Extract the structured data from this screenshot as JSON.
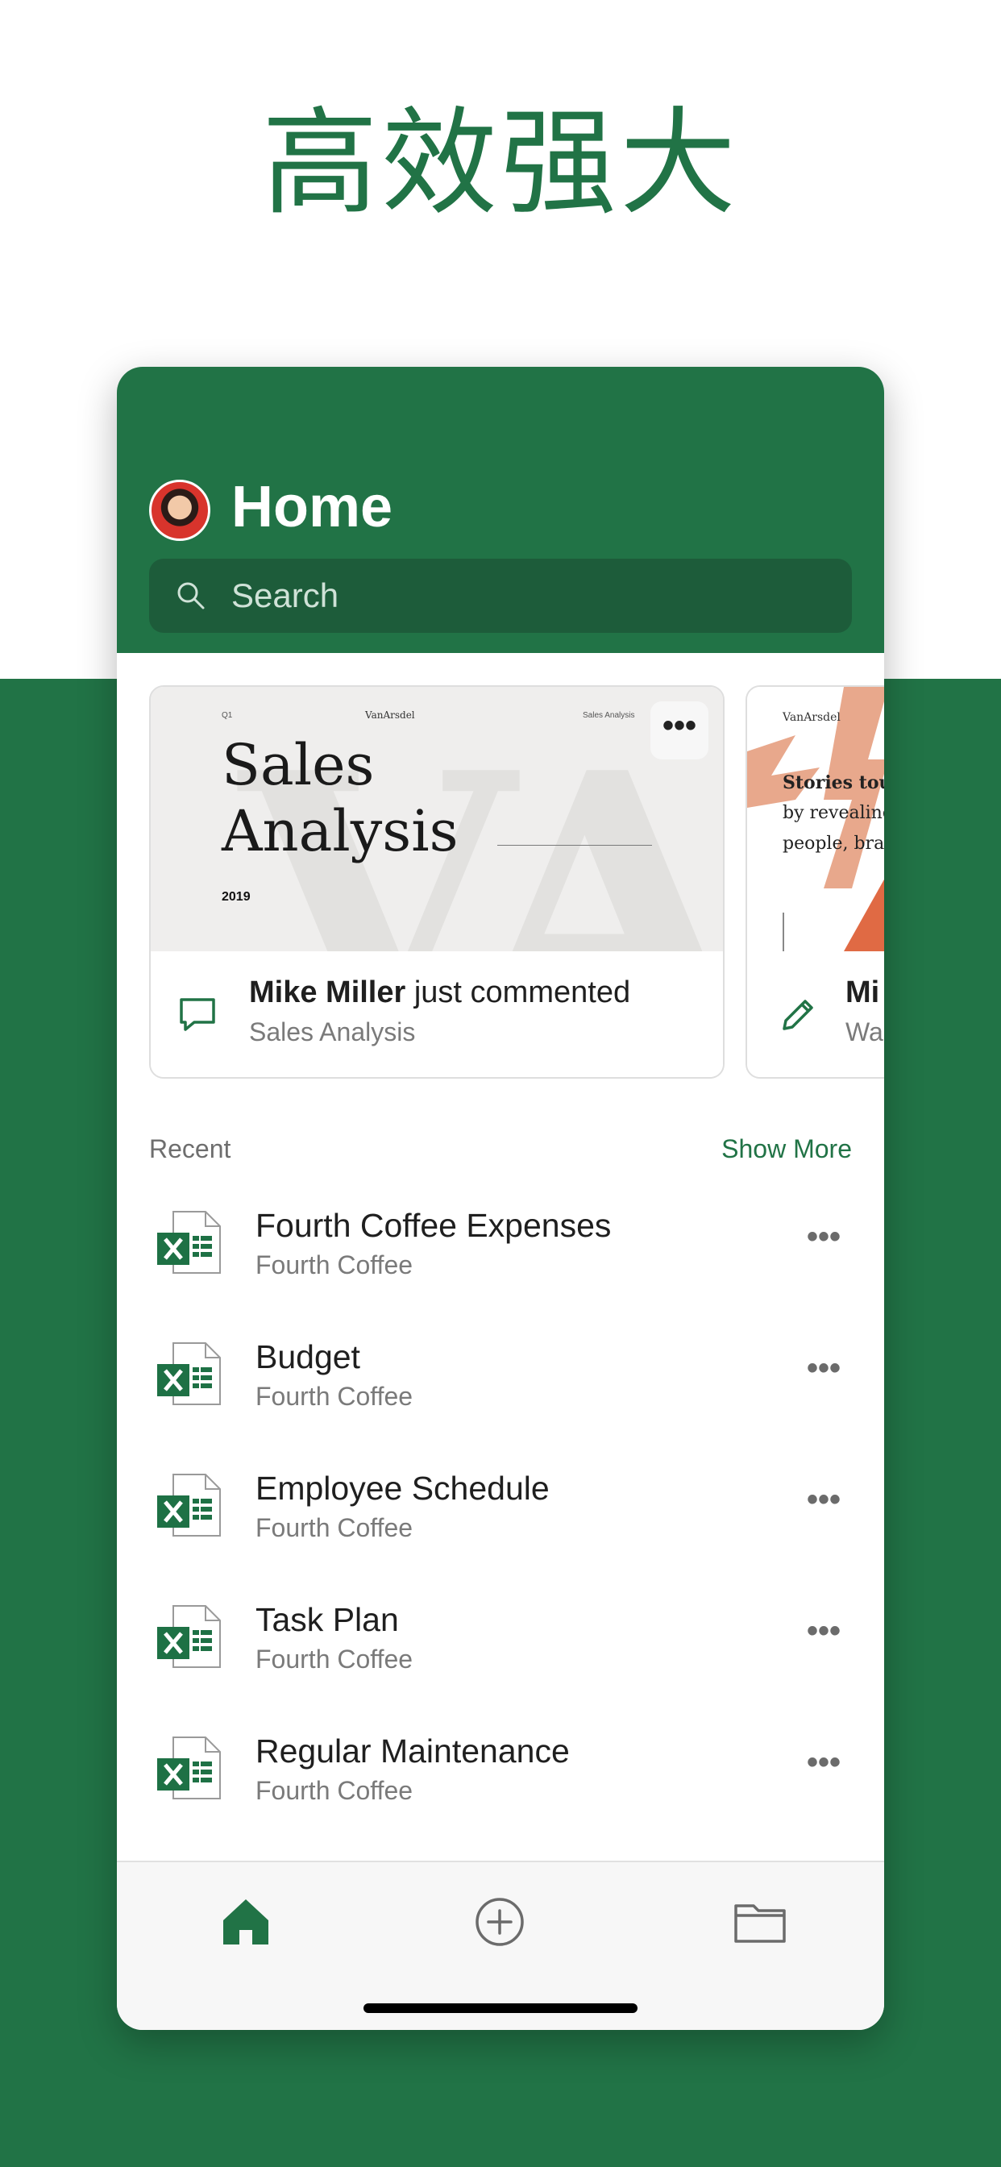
{
  "promo": {
    "headline": "高效强大"
  },
  "header": {
    "title": "Home",
    "search_placeholder": "Search"
  },
  "cards": [
    {
      "thumbnail": {
        "title_line1": "Sales",
        "title_line2": "Analysis",
        "year": "2019",
        "corner_left": "Q1",
        "brand": "VanArsdel",
        "corner_right": "Sales Analysis"
      },
      "activity_user": "Mike Miller",
      "activity_action": " just commented",
      "file_name": "Sales Analysis",
      "icon": "comment-icon"
    },
    {
      "thumbnail": {
        "brand": "VanArsdel",
        "text_line1": "Stories touc",
        "text_line2": "by revealing",
        "text_line3": "people, bran"
      },
      "activity_user": "Mi",
      "file_name": "Wa",
      "icon": "pencil-icon"
    }
  ],
  "recent": {
    "label": "Recent",
    "show_more": "Show More",
    "items": [
      {
        "name": "Fourth Coffee Expenses",
        "location": "Fourth Coffee"
      },
      {
        "name": "Budget",
        "location": "Fourth Coffee"
      },
      {
        "name": "Employee Schedule",
        "location": "Fourth Coffee"
      },
      {
        "name": "Task Plan",
        "location": "Fourth Coffee"
      },
      {
        "name": "Regular Maintenance",
        "location": "Fourth Coffee"
      }
    ],
    "more_glyph": "•••"
  },
  "card_more_glyph": "•••",
  "tabbar": {
    "home_icon": "home-icon",
    "new_icon": "add-circle-icon",
    "open_icon": "folder-icon"
  },
  "colors": {
    "brand_green": "#217346",
    "search_bg": "#1d5c3a",
    "excel_green": "#1e7145"
  }
}
